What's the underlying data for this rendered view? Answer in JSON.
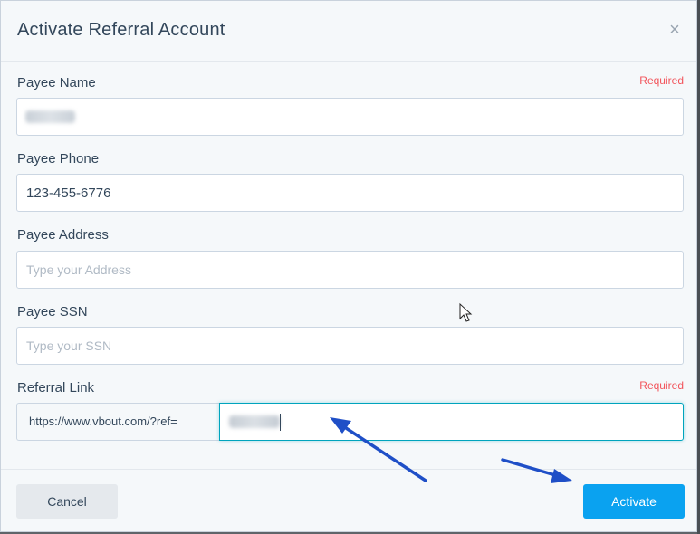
{
  "modal": {
    "title": "Activate Referral Account",
    "close_icon": "close-icon",
    "close_glyph": "×"
  },
  "fields": {
    "payee_name": {
      "label": "Payee Name",
      "required": "Required",
      "value": ""
    },
    "payee_phone": {
      "label": "Payee Phone",
      "value": "123-455-6776"
    },
    "payee_address": {
      "label": "Payee Address",
      "placeholder": "Type your Address"
    },
    "payee_ssn": {
      "label": "Payee SSN",
      "placeholder": "Type your SSN"
    },
    "referral_link": {
      "label": "Referral Link",
      "required": "Required",
      "prefix": "https://www.vbout.com/?ref="
    }
  },
  "footer": {
    "cancel_label": "Cancel",
    "activate_label": "Activate"
  },
  "colors": {
    "accent": "#0aa2f0",
    "required": "#f2545b",
    "annotation_arrow": "#1f4fc7"
  },
  "annotations": {
    "arrows": [
      "arrow-to-referral-input",
      "arrow-to-activate-button"
    ],
    "cursor_icon": "mouse-pointer-icon"
  }
}
